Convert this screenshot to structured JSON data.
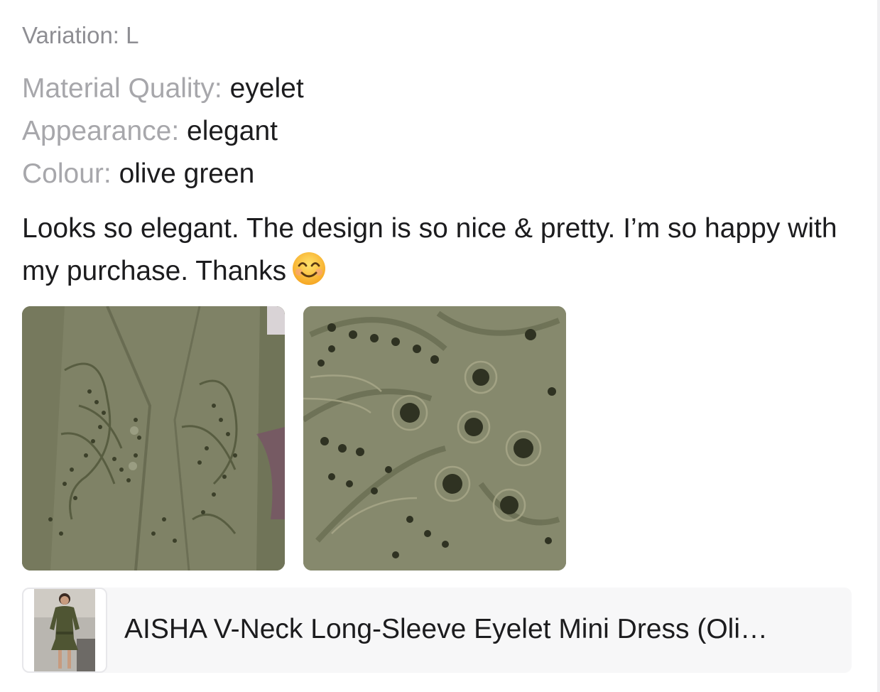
{
  "review": {
    "variation": "Variation: L",
    "attributes": [
      {
        "label": "Material Quality:",
        "value": "eyelet"
      },
      {
        "label": "Appearance:",
        "value": "elegant"
      },
      {
        "label": "Colour:",
        "value": "olive green"
      }
    ],
    "text": "Looks so elegant. The design is so nice & pretty. I’m so happy with my purchase. Thanks",
    "emoji": "smiling-face-icon",
    "photos": [
      {
        "alt": "olive green eyelet dress front detail"
      },
      {
        "alt": "olive green eyelet fabric close-up"
      }
    ]
  },
  "product": {
    "title": "AISHA V-Neck Long-Sleeve Eyelet Mini Dress (Oli…",
    "thumbnail_alt": "woman wearing olive eyelet mini dress"
  },
  "colors": {
    "label_gray": "#a7a7ab",
    "text_dark": "#1c1c1e",
    "card_background": "#f7f7f8",
    "olive": "#7d8063"
  }
}
